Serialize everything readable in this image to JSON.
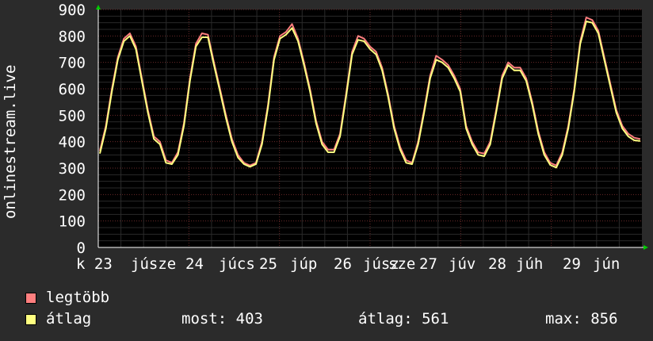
{
  "chart_data": {
    "type": "line",
    "ylabel": "onlinestream.live",
    "ylim": [
      0,
      900
    ],
    "yticks": [
      0,
      100,
      200,
      300,
      400,
      500,
      600,
      700,
      800,
      900
    ],
    "x_tick_labels": [
      "k 23",
      "júsze",
      "24",
      "júcs",
      "25",
      "júp",
      "26",
      "júsz",
      "sze",
      "27",
      "júv",
      "28",
      "júh",
      "29",
      "jún"
    ],
    "grid": true,
    "series": [
      {
        "name": "legtöbb",
        "color": "#ff7f7f",
        "values": [
          365,
          460,
          600,
          720,
          790,
          810,
          760,
          640,
          520,
          420,
          400,
          330,
          320,
          360,
          470,
          640,
          770,
          810,
          805,
          700,
          600,
          500,
          410,
          350,
          320,
          310,
          320,
          400,
          540,
          720,
          800,
          815,
          845,
          790,
          700,
          600,
          480,
          400,
          370,
          370,
          430,
          580,
          740,
          800,
          790,
          760,
          740,
          680,
          580,
          460,
          380,
          330,
          320,
          400,
          520,
          650,
          725,
          710,
          690,
          650,
          600,
          460,
          400,
          360,
          355,
          400,
          520,
          650,
          700,
          680,
          680,
          640,
          550,
          440,
          360,
          320,
          310,
          360,
          460,
          600,
          780,
          870,
          860,
          820,
          720,
          620,
          520,
          460,
          430,
          415,
          410
        ]
      },
      {
        "name": "átlag",
        "color": "#ffff80",
        "values": [
          355,
          450,
          590,
          710,
          780,
          800,
          750,
          630,
          510,
          410,
          390,
          320,
          315,
          350,
          460,
          630,
          760,
          795,
          795,
          690,
          590,
          490,
          400,
          340,
          315,
          305,
          315,
          390,
          530,
          710,
          790,
          805,
          830,
          780,
          690,
          590,
          470,
          390,
          360,
          360,
          420,
          570,
          730,
          785,
          780,
          750,
          730,
          670,
          570,
          450,
          370,
          320,
          315,
          390,
          510,
          640,
          710,
          700,
          680,
          640,
          590,
          450,
          390,
          350,
          345,
          390,
          510,
          640,
          690,
          670,
          670,
          630,
          540,
          430,
          350,
          312,
          302,
          350,
          450,
          590,
          770,
          855,
          850,
          810,
          710,
          610,
          510,
          450,
          420,
          405,
          403
        ]
      }
    ]
  },
  "legend": {
    "items": [
      {
        "label": "legtöbb",
        "color": "#ff7f7f"
      },
      {
        "label": "átlag",
        "color": "#ffff80"
      }
    ]
  },
  "stats": {
    "now": "most: 403",
    "avg": "átlag: 561",
    "max": "max: 856"
  }
}
